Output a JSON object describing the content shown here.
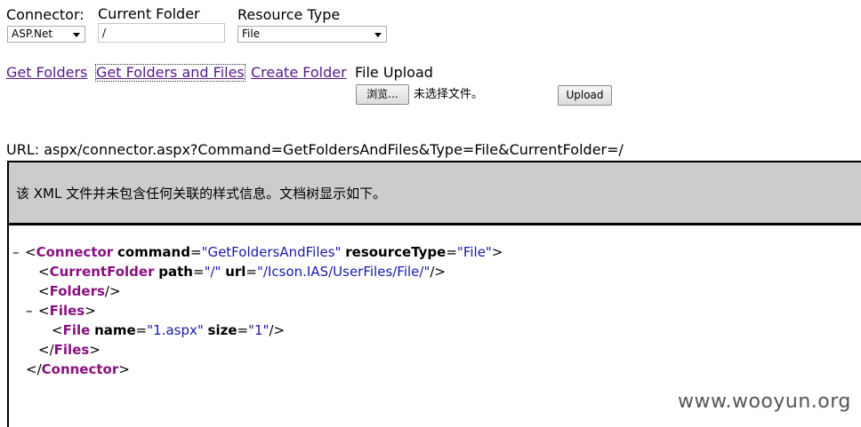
{
  "form": {
    "connector_label": "Connector:",
    "connector_value": "ASP.Net",
    "current_folder_label": "Current Folder",
    "current_folder_value": "/",
    "resource_type_label": "Resource Type",
    "resource_type_value": "File"
  },
  "actions": {
    "get_folders": "Get Folders",
    "get_folders_and_files": "Get Folders and Files",
    "create_folder": "Create Folder",
    "file_upload_label": "File Upload",
    "browse_button": "浏览...",
    "no_file_selected": "未选择文件。",
    "upload_button": "Upload"
  },
  "url_line": "URL: aspx/connector.aspx?Command=GetFoldersAndFiles&Type=File&CurrentFolder=/",
  "xml_notice": "该 XML 文件并未包含任何关联的样式信息。文档树显示如下。",
  "xml": {
    "toggle": "–",
    "connector_tag": "Connector",
    "attr_command": "command",
    "val_command": "\"GetFoldersAndFiles\"",
    "attr_resource_type": "resourceType",
    "val_resource_type": "\"File\"",
    "current_folder_tag": "CurrentFolder",
    "attr_path": "path",
    "val_path": "\"/\"",
    "attr_url": "url",
    "val_url": "\"/Icson.IAS/UserFiles/File/\"",
    "folders_tag": "Folders",
    "files_tag": "Files",
    "file_tag": "File",
    "attr_name": "name",
    "val_name": "\"1.aspx\"",
    "attr_size": "size",
    "val_size": "\"1\""
  },
  "watermark": "www.wooyun.org"
}
